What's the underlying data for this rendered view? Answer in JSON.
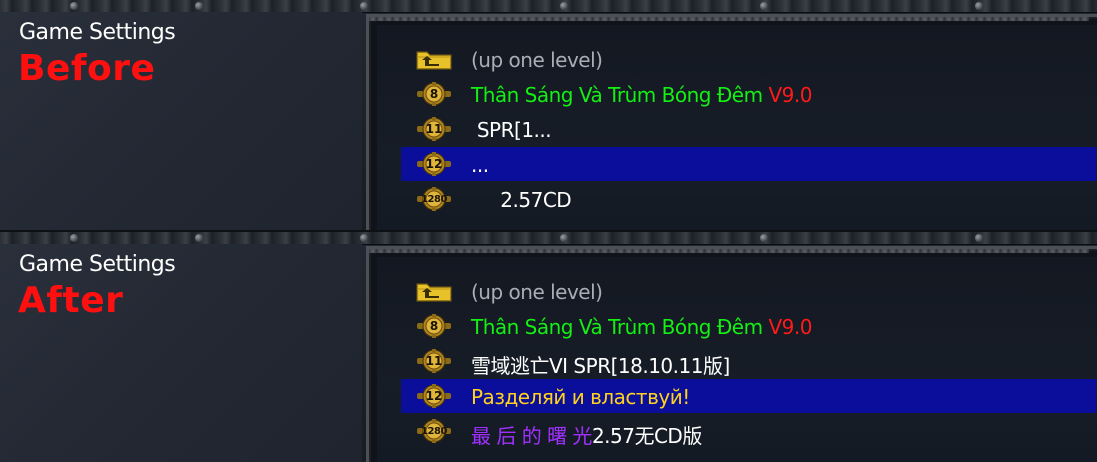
{
  "panels": [
    {
      "settings_title": "Game Settings",
      "state_label": "Before",
      "rows": [
        {
          "icon": "folder-up-icon",
          "badge": "",
          "parts": [
            {
              "text": "(up one level)",
              "color": "gray"
            }
          ]
        },
        {
          "icon": "gear-badge-icon",
          "badge": "8",
          "parts": [
            {
              "text": "Thân Sáng Và Trùm Bóng Đêm ",
              "color": "green"
            },
            {
              "text": "V9.0",
              "color": "red"
            }
          ]
        },
        {
          "icon": "gear-badge-icon",
          "badge": "11",
          "parts": [
            {
              "text": " SPR[1...",
              "color": "white"
            }
          ]
        },
        {
          "icon": "gear-badge-icon",
          "badge": "12",
          "parts": [
            {
              "text": "...",
              "color": "white"
            }
          ]
        },
        {
          "icon": "gear-badge-icon",
          "badge": "1280",
          "parts": [
            {
              "text": "     2.57CD",
              "color": "white"
            }
          ]
        }
      ],
      "selected_index": 3
    },
    {
      "settings_title": "Game Settings",
      "state_label": "After",
      "rows": [
        {
          "icon": "folder-up-icon",
          "badge": "",
          "parts": [
            {
              "text": "(up one level)",
              "color": "gray"
            }
          ]
        },
        {
          "icon": "gear-badge-icon",
          "badge": "8",
          "parts": [
            {
              "text": "Thân Sáng Và Trùm Bóng Đêm ",
              "color": "green"
            },
            {
              "text": "V9.0",
              "color": "red"
            }
          ]
        },
        {
          "icon": "gear-badge-icon",
          "badge": "11",
          "parts": [
            {
              "text": "雪域逃亡VI SPR[18.10.11版]",
              "color": "white"
            }
          ]
        },
        {
          "icon": "gear-badge-icon",
          "badge": "12",
          "parts": [
            {
              "text": "Разделяй и властвуй!",
              "color": "yellow"
            }
          ]
        },
        {
          "icon": "gear-badge-icon",
          "badge": "1280",
          "parts": [
            {
              "text": "最 后 的 曙 光",
              "color": "purple"
            },
            {
              "text": "2.57无CD版",
              "color": "white"
            }
          ]
        }
      ],
      "selected_index": 3
    }
  ],
  "colors": {
    "selection": "#0a0e9a",
    "state_label": "#ff1010",
    "green": "#14f014",
    "red": "#ff1a1a",
    "gray": "#a9adb5",
    "white": "#ffffff",
    "yellow": "#ffd21e",
    "purple": "#a030ff",
    "gear_gold": "#c89a2a"
  }
}
